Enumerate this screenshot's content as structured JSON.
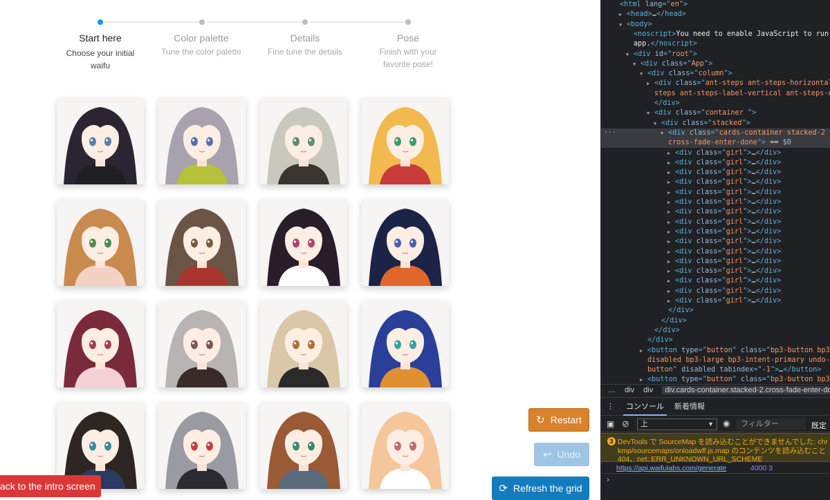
{
  "steps": [
    {
      "title": "Start here",
      "desc": [
        "Choose your initial",
        "waifu"
      ],
      "active": true
    },
    {
      "title": "Color palette",
      "desc": [
        "Tune the color palette"
      ],
      "active": false
    },
    {
      "title": "Details",
      "desc": [
        "Fine tune the details"
      ],
      "active": false
    },
    {
      "title": "Pose",
      "desc": [
        "Finish with your",
        "favorite pose!"
      ],
      "active": false
    }
  ],
  "grid": {
    "girls": [
      {
        "hair": "#2b2533",
        "eyes": "#5a7fa8",
        "outfit": "#1e1e24"
      },
      {
        "hair": "#a7a2ad",
        "eyes": "#5a6fa8",
        "outfit": "#b5c23a"
      },
      {
        "hair": "#c9c8bd",
        "eyes": "#5b9070",
        "outfit": "#3a3530"
      },
      {
        "hair": "#f2b94f",
        "eyes": "#3f9a6d",
        "outfit": "#c93a3a"
      },
      {
        "hair": "#c98a4e",
        "eyes": "#4f8c4a",
        "outfit": "#f3d2c4"
      },
      {
        "hair": "#6a5446",
        "eyes": "#7a5a3a",
        "outfit": "#a8362e"
      },
      {
        "hair": "#2a1d2a",
        "eyes": "#b04070",
        "outfit": "#ffffff"
      },
      {
        "hair": "#1b2447",
        "eyes": "#4a5fb0",
        "outfit": "#e0662a"
      },
      {
        "hair": "#7a2a3a",
        "eyes": "#a04050",
        "outfit": "#f4cfd6"
      },
      {
        "hair": "#b9b4b4",
        "eyes": "#7a5a4a",
        "outfit": "#3a2a2a"
      },
      {
        "hair": "#d9c7a8",
        "eyes": "#b07030",
        "outfit": "#2a2a2a"
      },
      {
        "hair": "#2a3f9a",
        "eyes": "#3aa0a0",
        "outfit": "#e09030"
      },
      {
        "hair": "#2e2622",
        "eyes": "#3a8aa0",
        "outfit": "#2a3a60"
      },
      {
        "hair": "#9a9aa2",
        "eyes": "#c0403a",
        "outfit": "#2a2a30"
      },
      {
        "hair": "#9a5a36",
        "eyes": "#3a8a6a",
        "outfit": "#5a6a7a"
      },
      {
        "hair": "#f4c69a",
        "eyes": "#c06a6a",
        "outfit": "#ffffff"
      }
    ]
  },
  "buttons": {
    "restart": "Restart",
    "undo": "Undo",
    "refresh": "Refresh the grid",
    "back": "ack to the intro screen"
  },
  "devtools": {
    "lines": [
      {
        "i": 0,
        "t": "tag",
        "tri": "",
        "parts": [
          [
            "tg",
            "<html "
          ],
          [
            "an",
            "lang"
          ],
          [
            "tg",
            "=\""
          ],
          [
            "av",
            "en"
          ],
          [
            "tg",
            "\">"
          ]
        ]
      },
      {
        "i": 1,
        "tri": "▶",
        "parts": [
          [
            "tg",
            "<head>"
          ],
          [
            "tx",
            "…"
          ],
          [
            "tg",
            "</head>"
          ]
        ]
      },
      {
        "i": 1,
        "tri": "▼",
        "parts": [
          [
            "tg",
            "<body>"
          ]
        ]
      },
      {
        "i": 2,
        "tri": "",
        "parts": [
          [
            "tg",
            "<noscript>"
          ],
          [
            "tx",
            "You need to enable JavaScript to run this"
          ]
        ]
      },
      {
        "i": 2,
        "tri": "",
        "parts": [
          [
            "tx",
            "app."
          ],
          [
            "tg",
            "</noscript>"
          ]
        ]
      },
      {
        "i": 2,
        "tri": "▼",
        "parts": [
          [
            "tg",
            "<div "
          ],
          [
            "an",
            "id"
          ],
          [
            "tg",
            "=\""
          ],
          [
            "av",
            "root"
          ],
          [
            "tg",
            "\">"
          ]
        ]
      },
      {
        "i": 3,
        "tri": "▼",
        "parts": [
          [
            "tg",
            "<div "
          ],
          [
            "an",
            "class"
          ],
          [
            "tg",
            "=\""
          ],
          [
            "av",
            "App"
          ],
          [
            "tg",
            "\">"
          ]
        ]
      },
      {
        "i": 4,
        "tri": "▼",
        "parts": [
          [
            "tg",
            "<div "
          ],
          [
            "an",
            "class"
          ],
          [
            "tg",
            "=\""
          ],
          [
            "av",
            "column"
          ],
          [
            "tg",
            "\">"
          ]
        ]
      },
      {
        "i": 5,
        "tri": "▶",
        "parts": [
          [
            "tg",
            "<div "
          ],
          [
            "an",
            "class"
          ],
          [
            "tg",
            "=\""
          ],
          [
            "av",
            "ant-steps ant-steps-horizontal"
          ]
        ]
      },
      {
        "i": 5,
        "tri": "",
        "parts": [
          [
            "av",
            "steps ant-steps-label-vertical ant-steps-dot"
          ],
          [
            "tg",
            "\">"
          ],
          [
            "tx",
            "…"
          ]
        ]
      },
      {
        "i": 5,
        "tri": "",
        "parts": [
          [
            "tg",
            "</div>"
          ]
        ]
      },
      {
        "i": 5,
        "tri": "▼",
        "parts": [
          [
            "tg",
            "<div "
          ],
          [
            "an",
            "class"
          ],
          [
            "tg",
            "=\""
          ],
          [
            "av",
            "container "
          ],
          [
            "tg",
            "\">"
          ]
        ]
      },
      {
        "i": 6,
        "tri": "▼",
        "parts": [
          [
            "tg",
            "<div "
          ],
          [
            "an",
            "class"
          ],
          [
            "tg",
            "=\""
          ],
          [
            "av",
            "stacked"
          ],
          [
            "tg",
            "\">"
          ]
        ]
      },
      {
        "i": 7,
        "tri": "▼",
        "sel": true,
        "parts": [
          [
            "tg",
            "<div "
          ],
          [
            "an",
            "class"
          ],
          [
            "tg",
            "=\""
          ],
          [
            "av",
            "cards-container stacked-2"
          ]
        ]
      },
      {
        "i": 7,
        "tri": "",
        "sel": true,
        "parts": [
          [
            "av",
            "cross-fade-enter-done"
          ],
          [
            "tg",
            "\">"
          ],
          [
            "tx",
            " == "
          ],
          [
            "an",
            "$0"
          ]
        ]
      },
      {
        "i": 8,
        "tri": "▶",
        "girl": true
      },
      {
        "i": 8,
        "tri": "▶",
        "girl": true
      },
      {
        "i": 8,
        "tri": "▶",
        "girl": true
      },
      {
        "i": 8,
        "tri": "▶",
        "girl": true
      },
      {
        "i": 8,
        "tri": "▶",
        "girl": true
      },
      {
        "i": 8,
        "tri": "▶",
        "girl": true
      },
      {
        "i": 8,
        "tri": "▶",
        "girl": true
      },
      {
        "i": 8,
        "tri": "▶",
        "girl": true
      },
      {
        "i": 8,
        "tri": "▶",
        "girl": true
      },
      {
        "i": 8,
        "tri": "▶",
        "girl": true
      },
      {
        "i": 8,
        "tri": "▶",
        "girl": true
      },
      {
        "i": 8,
        "tri": "▶",
        "girl": true
      },
      {
        "i": 8,
        "tri": "▶",
        "girl": true
      },
      {
        "i": 8,
        "tri": "▶",
        "girl": true
      },
      {
        "i": 8,
        "tri": "▶",
        "girl": true
      },
      {
        "i": 8,
        "tri": "▶",
        "girl": true
      },
      {
        "i": 7,
        "tri": "",
        "parts": [
          [
            "tg",
            "</div>"
          ]
        ]
      },
      {
        "i": 6,
        "tri": "",
        "parts": [
          [
            "tg",
            "</div>"
          ]
        ]
      },
      {
        "i": 5,
        "tri": "",
        "parts": [
          [
            "tg",
            "</div>"
          ]
        ]
      },
      {
        "i": 4,
        "tri": "",
        "parts": [
          [
            "tg",
            "</div>"
          ]
        ]
      },
      {
        "i": 4,
        "tri": "▶",
        "parts": [
          [
            "tg",
            "<button "
          ],
          [
            "an",
            "type"
          ],
          [
            "tg",
            "=\""
          ],
          [
            "av",
            "button"
          ],
          [
            "tg",
            "\" "
          ],
          [
            "an",
            "class"
          ],
          [
            "tg",
            "=\""
          ],
          [
            "av",
            "bp3-button bp3-"
          ]
        ]
      },
      {
        "i": 4,
        "tri": "",
        "parts": [
          [
            "av",
            "disabled bp3-large bp3-intent-primary undo-"
          ]
        ]
      },
      {
        "i": 4,
        "tri": "",
        "parts": [
          [
            "av",
            "button"
          ],
          [
            "tg",
            "\" "
          ],
          [
            "an",
            "disabled tabindex"
          ],
          [
            "tg",
            "=\""
          ],
          [
            "av",
            "-1"
          ],
          [
            "tg",
            "\">"
          ],
          [
            "tx",
            "…"
          ],
          [
            "tg",
            "</button>"
          ]
        ]
      },
      {
        "i": 4,
        "tri": "▶",
        "parts": [
          [
            "tg",
            "<button "
          ],
          [
            "an",
            "type"
          ],
          [
            "tg",
            "=\""
          ],
          [
            "av",
            "button"
          ],
          [
            "tg",
            "\" "
          ],
          [
            "an",
            "class"
          ],
          [
            "tg",
            "=\""
          ],
          [
            "av",
            "bp3-button bp3-"
          ]
        ]
      }
    ],
    "girl_line": [
      [
        "tg",
        "<div "
      ],
      [
        "an",
        "class"
      ],
      [
        "tg",
        "=\""
      ],
      [
        "av",
        "girl"
      ],
      [
        "tg",
        "\">"
      ],
      [
        "tx",
        "…"
      ],
      [
        "tg",
        "</div>"
      ]
    ],
    "breadcrumbs": [
      "…",
      "div",
      "div",
      "div.cards-container.stacked-2.cross-fade-enter-done"
    ],
    "tabs": [
      "⋮",
      "コンソール",
      "新着情報"
    ],
    "context": "上",
    "filter_placeholder": "フィルター",
    "level": "既定の",
    "warning": {
      "count": "3",
      "line1": "DevTools で SourceMap を読み込むことができませんでした: chr",
      "line2": "kmp/sourcemaps/onloadwff.js.map のコンテンツを読み込むこと",
      "line3": "404、net::ERR_UNKNOWN_URL_SCHEME"
    },
    "log": {
      "url": "https://api.waifulabs.com/generate",
      "value": "4000 3"
    },
    "prompt": "›"
  },
  "colors": {
    "step_active": "#1890ff",
    "restart": "#d9822b",
    "refresh": "#137cbd",
    "back": "#db3737"
  }
}
